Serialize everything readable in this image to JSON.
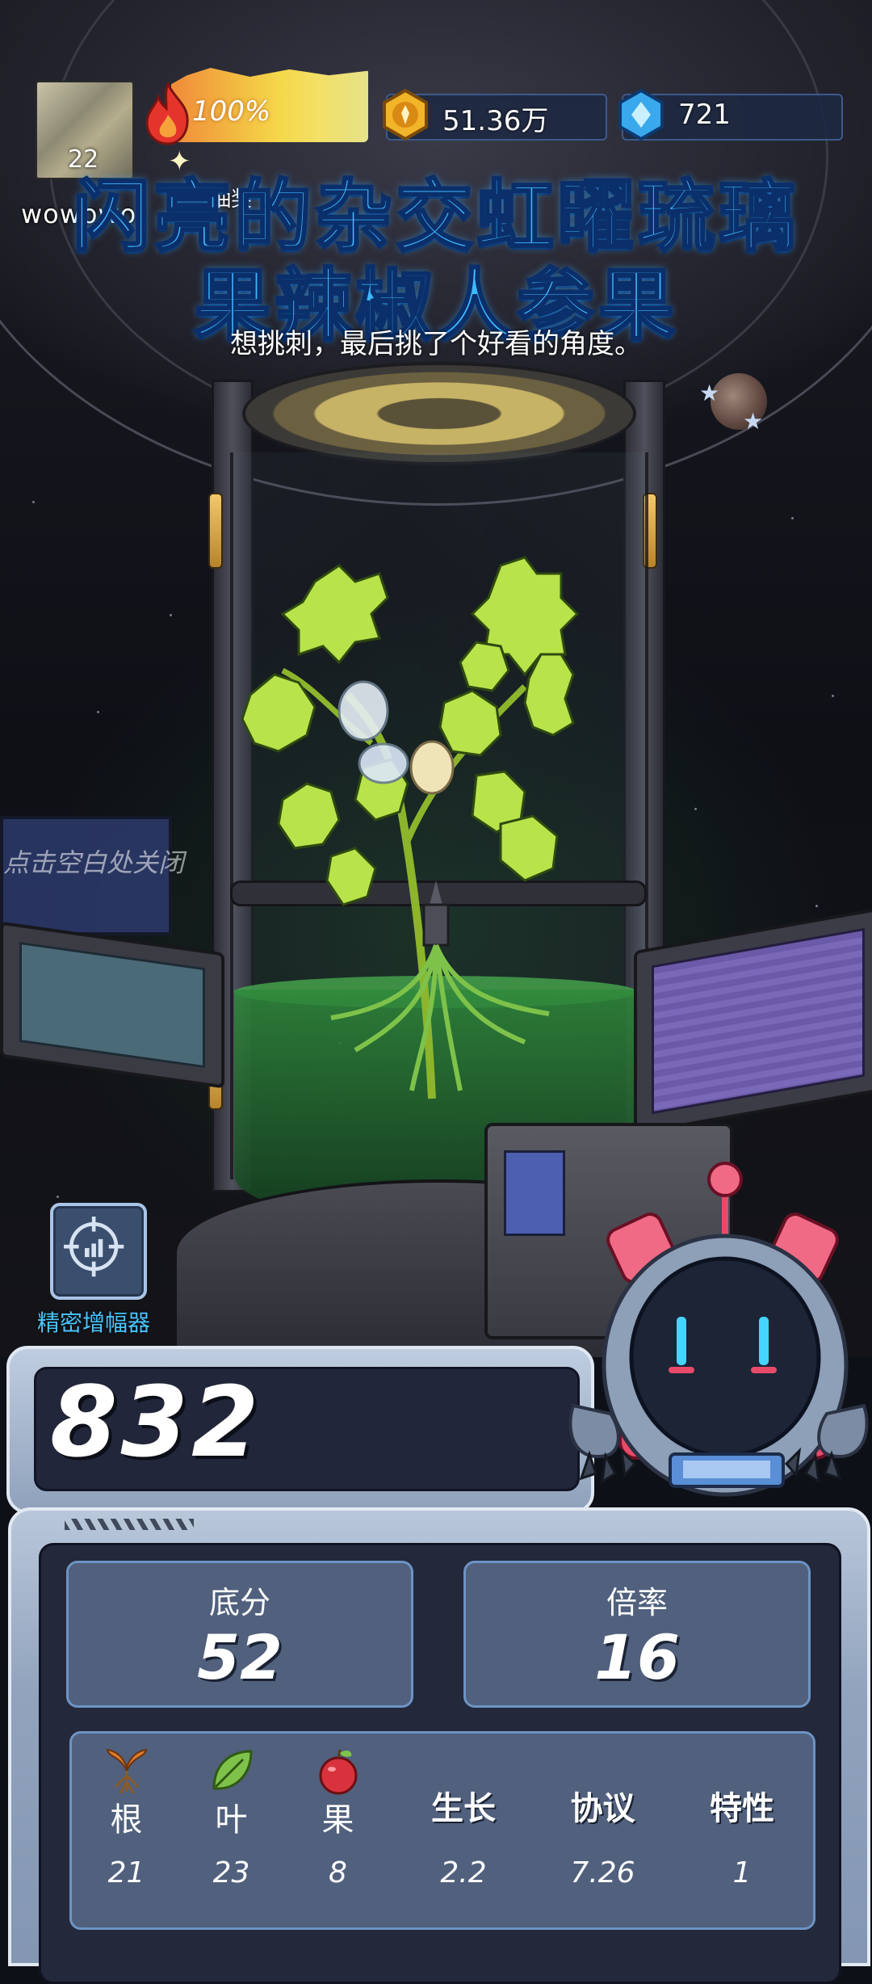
{
  "player": {
    "username": "wowowo",
    "level": "22"
  },
  "hud": {
    "energy_percent": "100%",
    "energy_fill": 1.0,
    "lottery_label": "满星抽奖",
    "coins": "51.36万",
    "gems": "721"
  },
  "title": {
    "line1": "闪亮的杂交虹曜琉璃",
    "line2": "果辣椒人参果",
    "subtitle": "想挑刺，最后挑了个好看的角度。"
  },
  "close_hint": "点击空白处关闭",
  "amplifier": {
    "label": "精密增幅器",
    "icon": "target-icon"
  },
  "score": "832",
  "stats": {
    "base": {
      "label": "底分",
      "value": "52"
    },
    "multiplier": {
      "label": "倍率",
      "value": "16"
    }
  },
  "attributes": [
    {
      "label": "根",
      "value": "21",
      "icon": "root-icon"
    },
    {
      "label": "叶",
      "value": "23",
      "icon": "leaf-icon"
    },
    {
      "label": "果",
      "value": "8",
      "icon": "fruit-icon"
    },
    {
      "label": "生长",
      "value": "2.2"
    },
    {
      "label": "协议",
      "value": "7.26"
    },
    {
      "label": "特性",
      "value": "1"
    }
  ],
  "colors": {
    "title": "#3fb8ff",
    "panel": "#50607d",
    "panel_border": "#6d93c4",
    "amplifier_label": "#4bc4ff"
  }
}
